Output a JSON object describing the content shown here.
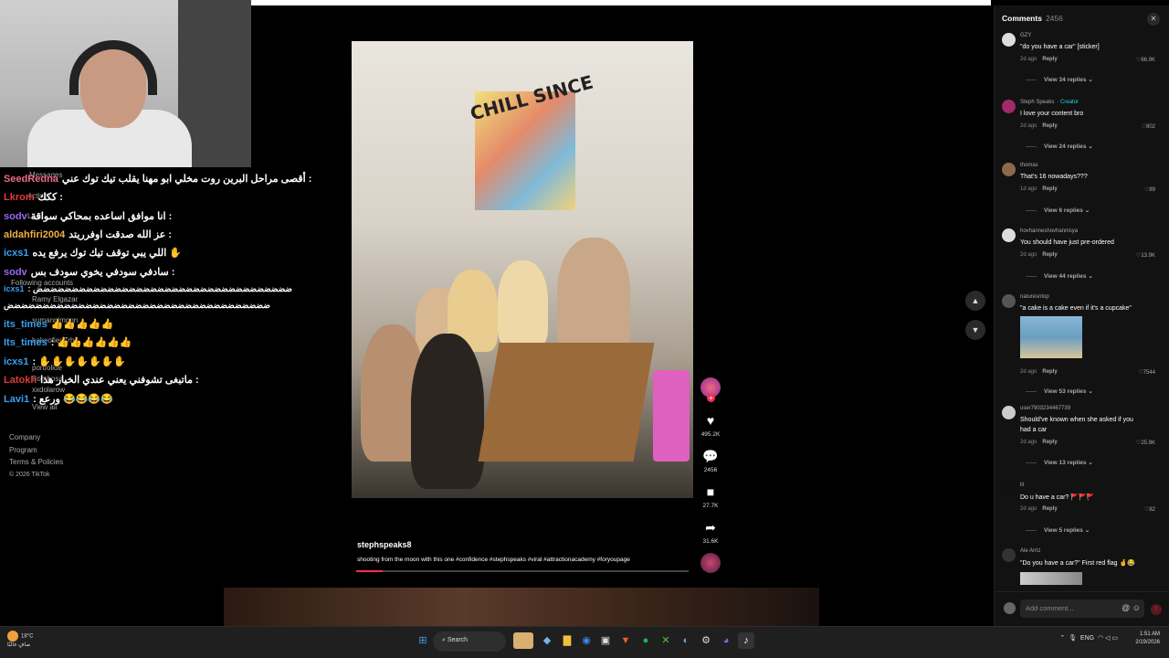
{
  "chat": {
    "lines": [
      {
        "user": "SeedRedna",
        "color": "#f06a8a",
        "msg": "أقصى مراحل البرين روت مخلي ابو مهنا يقلب تيك توك عني :"
      },
      {
        "user": "Lkrom",
        "color": "#e03a3a",
        "msg": "ككك :"
      },
      {
        "user": "sodv",
        "color": "#9a6af0",
        "msg": "انا موافق اساعده بمحاكي سواقة :"
      },
      {
        "user": "aldahfiri2004",
        "color": "#f0b040",
        "msg": "عز الله صدقت اوفرريتد :"
      },
      {
        "user": "icxs1",
        "color": "#3aa0f0",
        "msg": "اللي يبي توقف تيك توك يرفع يده ✋"
      },
      {
        "user": "sodv",
        "color": "#9a6af0",
        "msg": "سادفي سودفي يخوي سودف بس :"
      },
      {
        "user": "icxs1",
        "color": "#3aa0f0",
        "msg": ": ضضضضضضضضضضضضضضضضضضضضضضضضضضضضضضضضضضضض"
      },
      {
        "user": "",
        "color": "#fff",
        "msg": "ضضضضضضضضضضضضضضضضضضضضضضضضضضضضضضضضضضضضض"
      },
      {
        "user": "its_times",
        "color": "#3aa0f0",
        "msg": "👍👍👍👍👍"
      },
      {
        "user": "Its_times",
        "color": "#3aa0f0",
        "msg": ": 👍👍👍👍👍👍"
      },
      {
        "user": "icxs1",
        "color": "#3aa0f0",
        "msg": ": ✋✋✋✋✋✋✋"
      },
      {
        "user": "Latokh",
        "color": "#e03a3a",
        "msg": "ماتبغى تشوفني يعني عندي الخيار هذا :"
      },
      {
        "user": "Lavi1",
        "color": "#3aa0f0",
        "msg": ": ورعع 😂😂😂😂"
      }
    ],
    "ghost": [
      "Messages",
      "Activity",
      "LIVE",
      "Following accounts",
      "Ramy Elgazar",
      "sumannimpon",
      "bakeofiedTrh",
      "portfolioe",
      "Bombosa",
      "xxdolarow",
      "View all"
    ]
  },
  "left_footer": {
    "links": [
      "Company",
      "Program",
      "Terms & Policies"
    ],
    "copyright": "© 2026 TikTok"
  },
  "video": {
    "mural_text": "CHILL SINCE",
    "username": "stephspeaks8",
    "caption": "shooting from the moon with this one #confidence #stephspeaks #viral #attractionacademy #foryoupage",
    "progress": 0.08,
    "likes": "495.2K",
    "comments": "2456",
    "saves": "27.7K",
    "shares": "31.6K"
  },
  "comments_panel": {
    "title": "Comments",
    "count": "2456",
    "input_placeholder": "Add comment...",
    "items": [
      {
        "user": "GZY",
        "creator": "",
        "text": "\"do you have a car\" [sticker]",
        "time": "2d ago",
        "reply": "Reply",
        "likes": "66.9K",
        "view": "View 34 replies"
      },
      {
        "user": "Steph Speaks",
        "creator": "· Creator",
        "text": "I love your content bro",
        "time": "2d ago",
        "reply": "Reply",
        "likes": "802",
        "view": "View 24 replies"
      },
      {
        "user": "thomas",
        "creator": "",
        "text": "That's 16 nowadays???",
        "time": "1d ago",
        "reply": "Reply",
        "likes": "89",
        "view": "View 6 replies"
      },
      {
        "user": "hovhanneshovhannisya",
        "creator": "",
        "text": "You should have just pre-ordered",
        "time": "2d ago",
        "reply": "Reply",
        "likes": "13.9K",
        "view": "View 44 replies"
      },
      {
        "user": "naturesntop",
        "creator": "",
        "text": "\"a cake is a cake even if it's a cupcake\"",
        "time": "2d ago",
        "reply": "Reply",
        "likes": "7544",
        "view": "View 53 replies"
      },
      {
        "user": "user7903234467739",
        "creator": "",
        "text": "Should've known when she asked if you",
        "text2": "had a car",
        "time": "2d ago",
        "reply": "Reply",
        "likes": "25.9K",
        "view": "View 13 replies"
      },
      {
        "user": "lil",
        "creator": "",
        "text": "Do u have a car? 🚩🚩🚩",
        "time": "2d ago",
        "reply": "Reply",
        "likes": "82",
        "view": "View 5 replies"
      },
      {
        "user": "Ale Arriz",
        "creator": "",
        "text": "\"Do you have a car?\" First red flag 🤞😂",
        "time": "",
        "reply": "",
        "likes": "",
        "view": ""
      }
    ]
  },
  "taskbar": {
    "weather_temp": "18°C",
    "weather_desc": "صافٍ غالبًا",
    "search": "Search",
    "lang": "ENG",
    "time": "1:51 AM",
    "date": "2/19/2026"
  }
}
